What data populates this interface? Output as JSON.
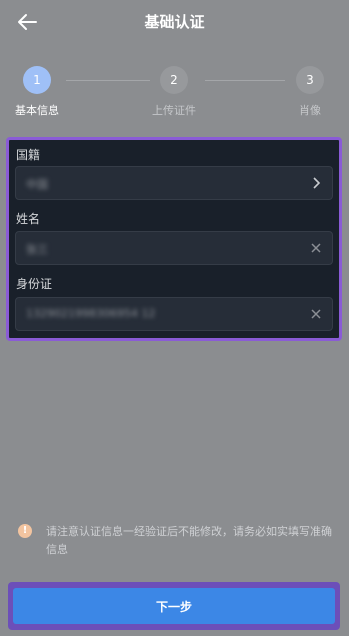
{
  "header": {
    "title": "基础认证"
  },
  "steps": [
    {
      "number": "1",
      "label": "基本信息",
      "active": true
    },
    {
      "number": "2",
      "label": "上传证件",
      "active": false
    },
    {
      "number": "3",
      "label": "肖像",
      "active": false
    }
  ],
  "form": {
    "nationality": {
      "label": "国籍",
      "value": "中国"
    },
    "name": {
      "label": "姓名",
      "value": "张三"
    },
    "id_card": {
      "label": "身份证",
      "value": "1329021998306954 12"
    }
  },
  "notice": {
    "text": "请注意认证信息一经验证后不能修改，请务必如实填写准确信息"
  },
  "next_button": {
    "label": "下一步"
  },
  "colors": {
    "accent": "#3c87e6",
    "step_active": "#9fc0f7",
    "highlight": "#8a5bd6"
  },
  "icons": {
    "back": "arrow-left-icon",
    "chevron": "chevron-right-icon",
    "clear": "close-icon",
    "warning": "warning-icon"
  }
}
